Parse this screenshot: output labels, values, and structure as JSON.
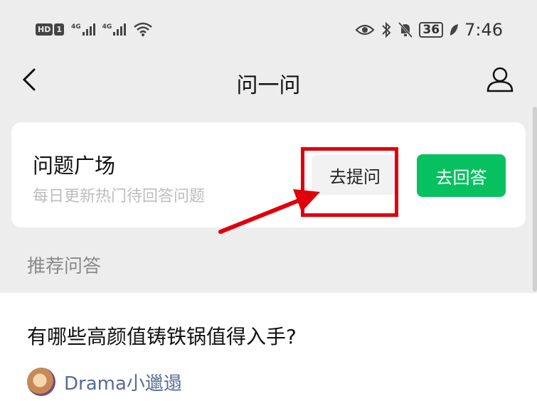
{
  "status_bar": {
    "hd_label": "HD",
    "sim_label": "1",
    "signal1_label": "4G",
    "signal2_label": "4G",
    "battery": "36",
    "time": "7:46",
    "icons": [
      "eye-icon",
      "bluetooth-icon",
      "mute-bell-icon",
      "leaf-icon",
      "wifi-icon"
    ]
  },
  "header": {
    "title": "问一问",
    "back_icon": "chevron-left-icon",
    "user_icon": "person-icon"
  },
  "card": {
    "title": "问题广场",
    "subtitle": "每日更新热门待回答问题",
    "ask_button": "去提问",
    "answer_button": "去回答"
  },
  "colors": {
    "accent": "#07c160",
    "highlight": "#e0000b",
    "link": "#576b95"
  },
  "section": {
    "label": "推荐问答"
  },
  "feed": {
    "items": [
      {
        "question": "有哪些高颜值铸铁锅值得入手?",
        "author": "Drama小邋遢"
      }
    ]
  }
}
